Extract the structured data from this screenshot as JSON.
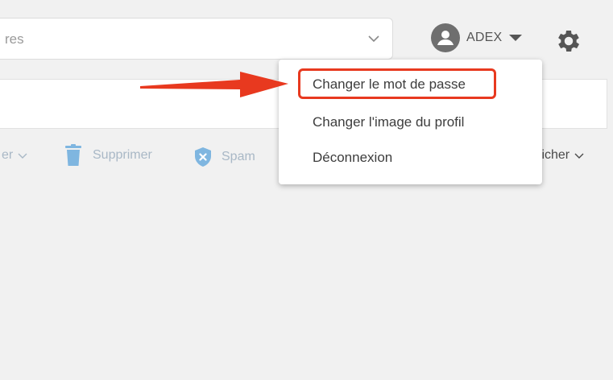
{
  "search": {
    "partial_text": "res"
  },
  "account": {
    "name": "ADEX"
  },
  "toolbar": {
    "partial_left_label": "er",
    "delete_label": "Supprimer",
    "spam_label": "Spam",
    "partial_right_label": "ficher"
  },
  "menu": {
    "items": [
      {
        "label": "Changer le mot de passe"
      },
      {
        "label": "Changer l'image du profil"
      },
      {
        "label": "Déconnexion"
      }
    ]
  },
  "colors": {
    "highlight": "#e8391f",
    "arrow": "#e8391f",
    "toolbar_icon": "#7fb6e0"
  },
  "icons": [
    "chevron-down-icon",
    "user-avatar-icon",
    "caret-down-icon",
    "gear-icon",
    "trash-icon",
    "shield-x-icon",
    "arrow-annotation-icon"
  ]
}
